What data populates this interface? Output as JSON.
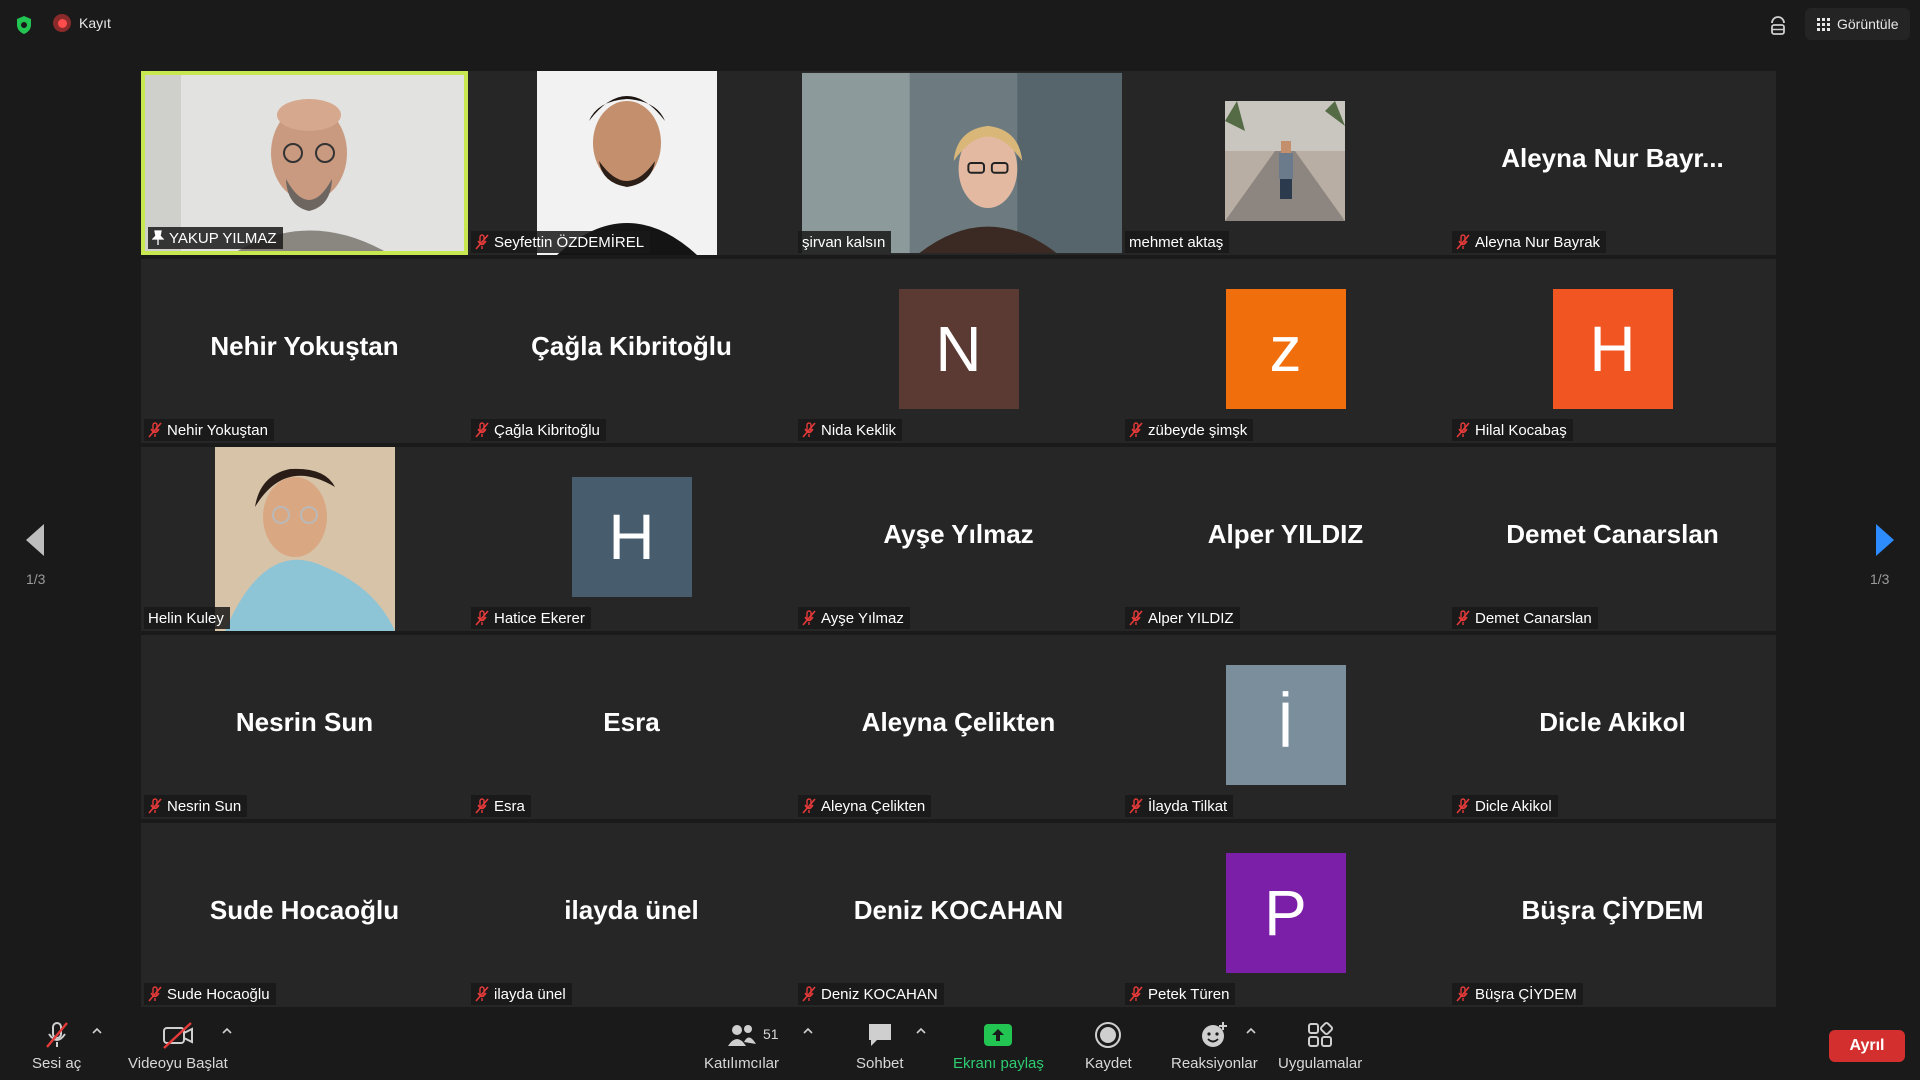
{
  "topbar": {
    "recording_label": "Kayıt",
    "view_label": "Görüntüle"
  },
  "gallery": {
    "page_left": "1/3",
    "page_right": "1/3",
    "tiles": [
      {
        "name": "YAKUP YILMAZ",
        "display": "",
        "kind": "photo"
      },
      {
        "name": "Seyfettin ÖZDEMİREL",
        "display": "",
        "kind": "photo"
      },
      {
        "name": "şirvan kalsın",
        "display": "",
        "kind": "photo"
      },
      {
        "name": "mehmet aktaş",
        "display": "",
        "kind": "photo"
      },
      {
        "name": "Aleyna Nur Bayrak",
        "display": "Aleyna Nur Bayr...",
        "kind": "text"
      },
      {
        "name": "Nehir Yokuştan",
        "display": "Nehir Yokuştan",
        "kind": "text"
      },
      {
        "name": "Çağla Kibritoğlu",
        "display": "Çağla Kibritoğlu",
        "kind": "text"
      },
      {
        "name": "Nida Keklik",
        "display": "N",
        "kind": "letter",
        "color": "#5b3a33"
      },
      {
        "name": "zübeyde şimşk",
        "display": "z",
        "kind": "letter",
        "color": "#f06e0b"
      },
      {
        "name": "Hilal Kocabaş",
        "display": "H",
        "kind": "letter",
        "color": "#f15522"
      },
      {
        "name": "Helin Kuley",
        "display": "",
        "kind": "photo"
      },
      {
        "name": "Hatice Ekerer",
        "display": "H",
        "kind": "letter",
        "color": "#475c6d"
      },
      {
        "name": "Ayşe Yılmaz",
        "display": "Ayşe Yılmaz",
        "kind": "text"
      },
      {
        "name": "Alper YILDIZ",
        "display": "Alper YILDIZ",
        "kind": "text"
      },
      {
        "name": "Demet Canarslan",
        "display": "Demet Canarslan",
        "kind": "text"
      },
      {
        "name": "Nesrin Sun",
        "display": "Nesrin Sun",
        "kind": "text"
      },
      {
        "name": "Esra",
        "display": "Esra",
        "kind": "text"
      },
      {
        "name": "Aleyna Çelikten",
        "display": "Aleyna Çelikten",
        "kind": "text"
      },
      {
        "name": "İlayda Tilkat",
        "display": "İ",
        "kind": "letter",
        "color": "#7a8f9b"
      },
      {
        "name": "Dicle Akikol",
        "display": "Dicle Akikol",
        "kind": "text"
      },
      {
        "name": "Sude Hocaoğlu",
        "display": "Sude Hocaoğlu",
        "kind": "text"
      },
      {
        "name": "ilayda ünel",
        "display": "ilayda ünel",
        "kind": "text"
      },
      {
        "name": "Deniz KOCAHAN",
        "display": "Deniz KOCAHAN",
        "kind": "text"
      },
      {
        "name": "Petek Türen",
        "display": "P",
        "kind": "letter",
        "color": "#7b1fa8"
      },
      {
        "name": "Büşra ÇİYDEM",
        "display": "Büşra ÇİYDEM",
        "kind": "text"
      }
    ]
  },
  "toolbar": {
    "unmute": "Sesi aç",
    "start_video": "Videoyu Başlat",
    "participants": "Katılımcılar",
    "participants_count": "51",
    "chat": "Sohbet",
    "share": "Ekranı paylaş",
    "record": "Kaydet",
    "reactions": "Reaksiyonlar",
    "apps": "Uygulamalar",
    "leave": "Ayrıl"
  }
}
